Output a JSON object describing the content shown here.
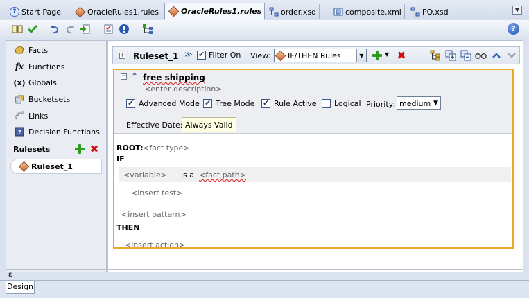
{
  "editor_tabs": [
    {
      "label": "Start Page",
      "icon": "help-icon"
    },
    {
      "label": "OracleRules1.rules",
      "icon": "rules-diamond-icon"
    },
    {
      "label": "OracleRules1.rules",
      "icon": "rules-diamond-icon",
      "active": true
    },
    {
      "label": "order.xsd",
      "icon": "schema-icon"
    },
    {
      "label": "composite.xml",
      "icon": "composite-icon"
    },
    {
      "label": "PO.xsd",
      "icon": "schema-icon"
    }
  ],
  "toolbar": {
    "help_label": "?"
  },
  "sidebar": {
    "items": [
      {
        "label": "Facts",
        "icon": "facts-icon"
      },
      {
        "label": "Functions",
        "icon": "function-icon",
        "glyph": "fx"
      },
      {
        "label": "Globals",
        "icon": "globals-icon",
        "glyph": "(x)"
      },
      {
        "label": "Bucketsets",
        "icon": "bucketsets-icon"
      },
      {
        "label": "Links",
        "icon": "links-icon"
      },
      {
        "label": "Decision Functions",
        "icon": "decision-function-icon"
      }
    ],
    "rulesets_header": "Rulesets",
    "ruleset_item": "Ruleset_1",
    "collapse_glyph": "ɛ"
  },
  "ruleset_toolbar": {
    "name": "Ruleset_1",
    "filter_label": "Filter On",
    "filter_checked": true,
    "view_label": "View:",
    "view_value": "IF/THEN Rules"
  },
  "rule": {
    "name": "free shipping",
    "description_placeholder": "<enter description>",
    "options": [
      {
        "label": "Advanced Mode",
        "checked": true
      },
      {
        "label": "Tree Mode",
        "checked": true
      },
      {
        "label": "Rule Active",
        "checked": true
      },
      {
        "label": "Logical",
        "checked": false
      }
    ],
    "priority_label": "Priority:",
    "priority_value": "medium",
    "effective_date_label": "Effective Date:",
    "effective_date_value": "Always Valid",
    "root_label": "ROOT:",
    "root_value": "<fact type>",
    "if_label": "IF",
    "variable_placeholder": "<variable>",
    "is_a_text": "is a",
    "fact_path_placeholder": "<fact path>",
    "insert_test": "<insert test>",
    "insert_pattern": "<insert pattern>",
    "then_label": "THEN",
    "insert_action": "<insert action>"
  },
  "bottom_tabs": [
    {
      "label": "Design",
      "active": true
    }
  ],
  "colors": {
    "rule_border": "#f0a627",
    "add_green": "#2f9b1e",
    "delete_red": "#d21010"
  }
}
